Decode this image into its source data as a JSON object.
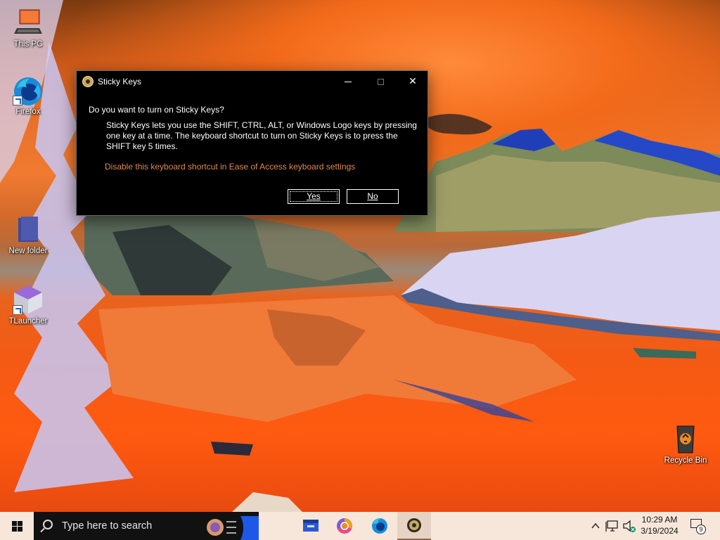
{
  "desktop": {
    "icons": [
      {
        "label": "This PC"
      },
      {
        "label": "Firefox"
      },
      {
        "label": "New folder"
      },
      {
        "label": "TLauncher"
      },
      {
        "label": "Recycle Bin"
      }
    ]
  },
  "dialog": {
    "title": "Sticky Keys",
    "question": "Do you want to turn on Sticky Keys?",
    "body": "Sticky Keys lets you use the SHIFT, CTRL, ALT, or Windows Logo keys by pressing one key at a time. The keyboard shortcut to turn on Sticky Keys is to press the SHIFT key 5 times.",
    "link": "Disable this keyboard shortcut in Ease of Access keyboard settings",
    "yes_label": "Yes",
    "no_label": "No",
    "minimize_glyph": "—",
    "close_glyph": "✕"
  },
  "taskbar": {
    "search_placeholder": "Type here to search",
    "apps": [
      "file-explorer-icon",
      "chrome-icon",
      "firefox-icon",
      "sticky-keys-icon"
    ],
    "clock_time": "10:29 AM",
    "clock_date": "3/19/2024",
    "notification_count": "9"
  },
  "colors": {
    "dialog_bg": "#000000",
    "link": "#e0894a",
    "taskbar_bg": "#f6e7da",
    "search_bg": "#111111"
  }
}
